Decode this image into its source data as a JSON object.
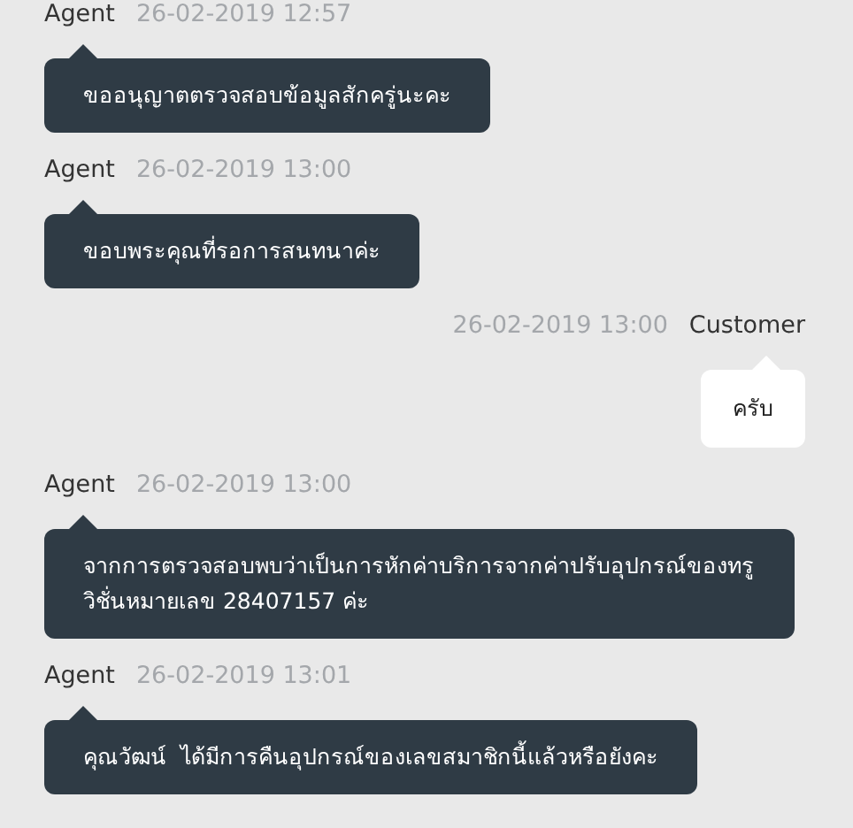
{
  "messages": [
    {
      "kind": "agent",
      "sender": "Agent",
      "time": "26-02-2019 12:57",
      "text": "ขออนุญาตตรวจสอบข้อมูลสักครู่นะคะ"
    },
    {
      "kind": "agent",
      "sender": "Agent",
      "time": "26-02-2019 13:00",
      "text": "ขอบพระคุณที่รอการสนทนาค่ะ"
    },
    {
      "kind": "customer",
      "sender": "Customer",
      "time": "26-02-2019 13:00",
      "text": "ครับ"
    },
    {
      "kind": "agent",
      "sender": "Agent",
      "time": "26-02-2019 13:00",
      "text": "จากการตรวจสอบพบว่าเป็นการหักค่าบริการจากค่าปรับอุปกรณ์ของทรูวิชั่นหมายเลข 28407157 ค่ะ"
    },
    {
      "kind": "agent",
      "sender": "Agent",
      "time": "26-02-2019 13:01",
      "text": "คุณวัฒน์  ได้มีการคืนอุปกรณ์ของเลขสมาชิกนี้แล้วหรือยังคะ"
    }
  ]
}
